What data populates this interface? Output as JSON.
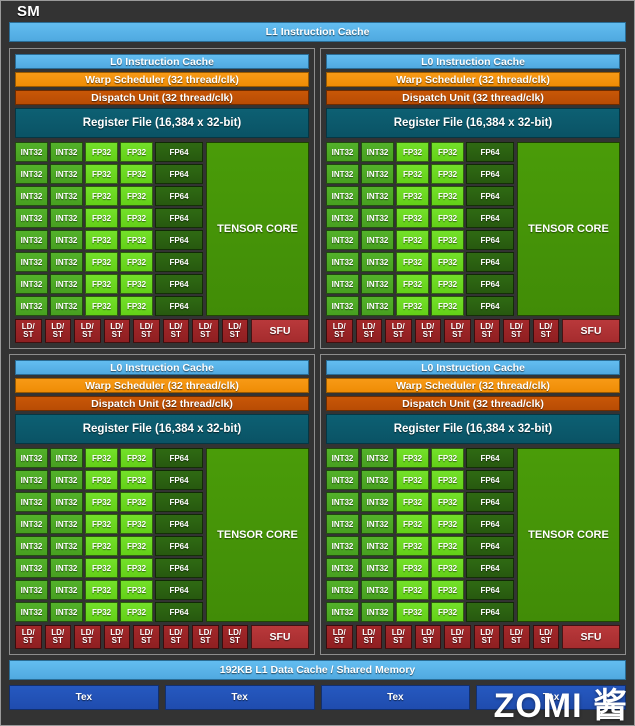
{
  "diagram": {
    "title": "SM",
    "l1_instruction_cache": "L1 Instruction Cache",
    "l1_data_cache": "192KB L1 Data Cache / Shared Memory",
    "watermark": "ZOMI 酱"
  },
  "processing_block": {
    "l0_instruction_cache": "L0 Instruction Cache",
    "warp_scheduler": "Warp Scheduler (32 thread/clk)",
    "dispatch_unit": "Dispatch Unit (32 thread/clk)",
    "register_file": "Register File (16,384 x 32-bit)",
    "tensor_core": "TENSOR CORE",
    "sfu": "SFU",
    "ldst_top": "LD/",
    "ldst_bottom": "ST",
    "core_labels": {
      "int32": "INT32",
      "fp32": "FP32",
      "fp64": "FP64"
    },
    "core_rows": 8,
    "int32_columns": 2,
    "fp32_columns": 2,
    "fp64_columns": 1,
    "ldst_count": 8,
    "sfu_count": 1
  },
  "tex_units": [
    "Tex",
    "Tex",
    "Tex",
    "Tex"
  ],
  "processing_block_count": 4,
  "colors": {
    "background": "#333333",
    "instruction_cache": "#4fa9e0",
    "warp_scheduler": "#ef8c05",
    "dispatch_unit": "#b84c04",
    "register_file": "#0a5365",
    "int32": "#47a020",
    "fp32": "#63d018",
    "fp64": "#27590f",
    "tensor_core": "#418c07",
    "ldst": "#8f1f21",
    "sfu": "#a52c2e",
    "tex": "#1f4cae"
  }
}
